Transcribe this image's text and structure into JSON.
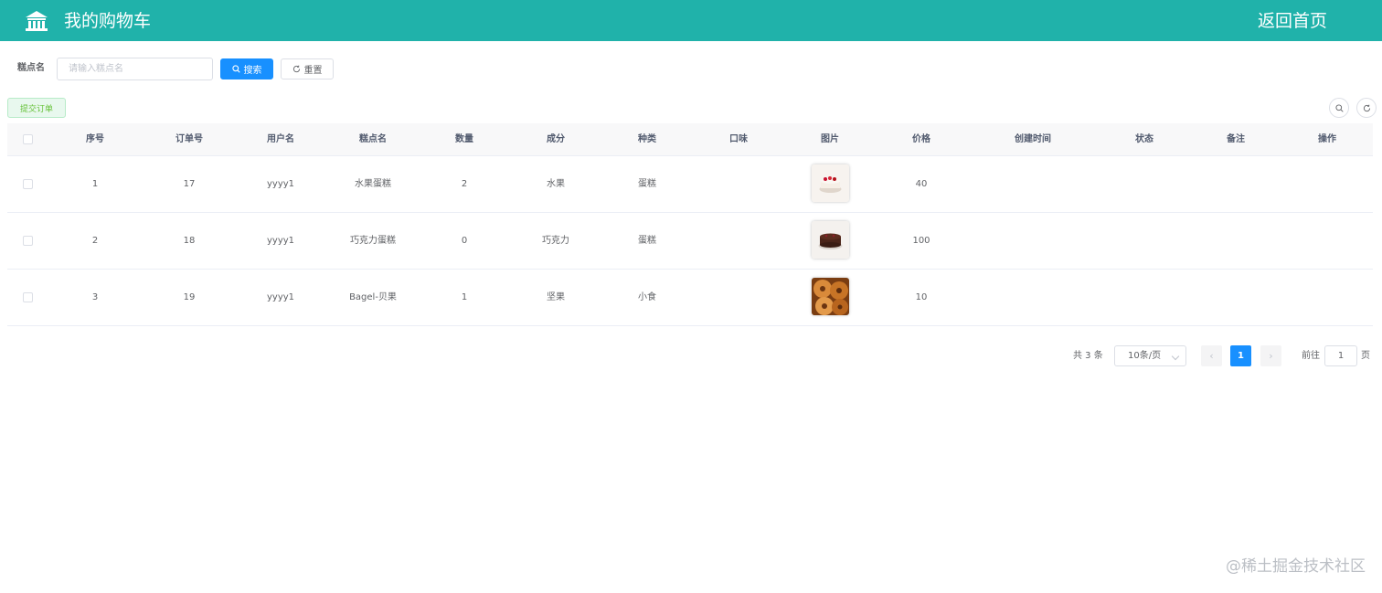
{
  "header": {
    "title": "我的购物车",
    "back_label": "返回首页"
  },
  "search": {
    "label": "糕点名",
    "placeholder": "请输入糕点名",
    "value": "",
    "search_label": "搜索",
    "reset_label": "重置"
  },
  "toolbar": {
    "submit_label": "提交订单"
  },
  "table": {
    "columns": [
      "序号",
      "订单号",
      "用户名",
      "糕点名",
      "数量",
      "成分",
      "种类",
      "口味",
      "图片",
      "价格",
      "创建时间",
      "状态",
      "备注",
      "操作"
    ],
    "rows": [
      {
        "index": "1",
        "order_no": "17",
        "username": "yyyy1",
        "name": "水果蛋糕",
        "qty": "2",
        "ingredient": "水果",
        "category": "蛋糕",
        "flavor": "",
        "image": "fruit-cake-photo",
        "price": "40",
        "created": "",
        "status": "",
        "remark": "",
        "action": ""
      },
      {
        "index": "2",
        "order_no": "18",
        "username": "yyyy1",
        "name": "巧克力蛋糕",
        "qty": "0",
        "ingredient": "巧克力",
        "category": "蛋糕",
        "flavor": "",
        "image": "chocolate-cake-photo",
        "price": "100",
        "created": "",
        "status": "",
        "remark": "",
        "action": ""
      },
      {
        "index": "3",
        "order_no": "19",
        "username": "yyyy1",
        "name": "Bagel-贝果",
        "qty": "1",
        "ingredient": "坚果",
        "category": "小食",
        "flavor": "",
        "image": "bagel-photo",
        "price": "10",
        "created": "",
        "status": "",
        "remark": "",
        "action": ""
      }
    ]
  },
  "pagination": {
    "total_label": "共 3 条",
    "page_size": "10条/页",
    "current_page": "1",
    "goto_label": "前往",
    "goto_value": "1",
    "goto_suffix": "页"
  },
  "watermark": "@稀土掘金技术社区",
  "colors": {
    "header": "#20b2aa",
    "primary": "#1890ff",
    "success_bg": "#e8f8ee"
  }
}
